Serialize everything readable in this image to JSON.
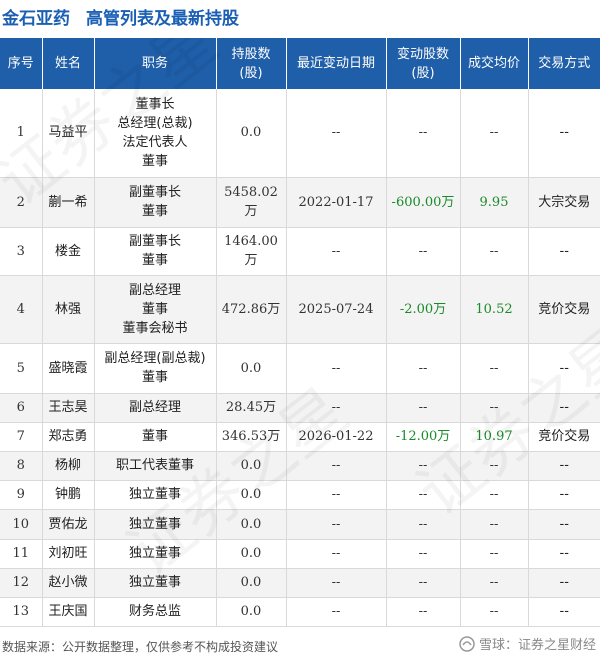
{
  "header": {
    "company": "金石亚药",
    "title": "高管列表及最新持股"
  },
  "table": {
    "columns": [
      "序号",
      "姓名",
      "职务",
      "持股数\n(股)",
      "最近变动日期",
      "变动股数\n(股)",
      "成交均价",
      "交易方式"
    ],
    "rows": [
      {
        "no": "1",
        "name": "马益平",
        "titles": [
          "董事长",
          "总经理(总裁)",
          "法定代表人",
          "董事"
        ],
        "shares": "0.0",
        "date": "--",
        "change": "--",
        "price": "--",
        "method": "--",
        "h": 88
      },
      {
        "no": "2",
        "name": "蒯一希",
        "titles": [
          "副董事长",
          "董事"
        ],
        "shares": "5458.02万",
        "date": "2022-01-17",
        "change": "-600.00万",
        "price": "9.95",
        "method": "大宗交易",
        "h": 50
      },
      {
        "no": "3",
        "name": "楼金",
        "titles": [
          "副董事长",
          "董事"
        ],
        "shares": "1464.00万",
        "date": "--",
        "change": "--",
        "price": "--",
        "method": "--",
        "h": 48
      },
      {
        "no": "4",
        "name": "林强",
        "titles": [
          "副总经理",
          "董事",
          "董事会秘书"
        ],
        "shares": "472.86万",
        "date": "2025-07-24",
        "change": "-2.00万",
        "price": "10.52",
        "method": "竞价交易",
        "h": 68
      },
      {
        "no": "5",
        "name": "盛晓霞",
        "titles": [
          "副总经理(副总裁)",
          "董事"
        ],
        "shares": "0.0",
        "date": "--",
        "change": "--",
        "price": "--",
        "method": "--",
        "h": 50
      },
      {
        "no": "6",
        "name": "王志昊",
        "titles": [
          "副总经理"
        ],
        "shares": "28.45万",
        "date": "--",
        "change": "--",
        "price": "--",
        "method": "--",
        "h": 29
      },
      {
        "no": "7",
        "name": "郑志勇",
        "titles": [
          "董事"
        ],
        "shares": "346.53万",
        "date": "2026-01-22",
        "change": "-12.00万",
        "price": "10.97",
        "method": "竞价交易",
        "h": 29
      },
      {
        "no": "8",
        "name": "杨柳",
        "titles": [
          "职工代表董事"
        ],
        "shares": "0.0",
        "date": "--",
        "change": "--",
        "price": "--",
        "method": "--",
        "h": 29
      },
      {
        "no": "9",
        "name": "钟鹏",
        "titles": [
          "独立董事"
        ],
        "shares": "0.0",
        "date": "--",
        "change": "--",
        "price": "--",
        "method": "--",
        "h": 29
      },
      {
        "no": "10",
        "name": "贾佑龙",
        "titles": [
          "独立董事"
        ],
        "shares": "0.0",
        "date": "--",
        "change": "--",
        "price": "--",
        "method": "--",
        "h": 30
      },
      {
        "no": "11",
        "name": "刘初旺",
        "titles": [
          "独立董事"
        ],
        "shares": "0.0",
        "date": "--",
        "change": "--",
        "price": "--",
        "method": "--",
        "h": 29
      },
      {
        "no": "12",
        "name": "赵小微",
        "titles": [
          "独立董事"
        ],
        "shares": "0.0",
        "date": "--",
        "change": "--",
        "price": "--",
        "method": "--",
        "h": 29
      },
      {
        "no": "13",
        "name": "王庆国",
        "titles": [
          "财务总监"
        ],
        "shares": "0.0",
        "date": "--",
        "change": "--",
        "price": "--",
        "method": "--",
        "h": 29
      }
    ]
  },
  "footer": {
    "source": "数据来源：公开数据整理，仅供参考不构成投资建议",
    "brand": "雪球：证券之星财经"
  },
  "watermark": {
    "text": "证券之星"
  },
  "colors": {
    "header_bg": "#1f5ea8",
    "title": "#1b5fb5",
    "negative": "#1b8a2a"
  }
}
